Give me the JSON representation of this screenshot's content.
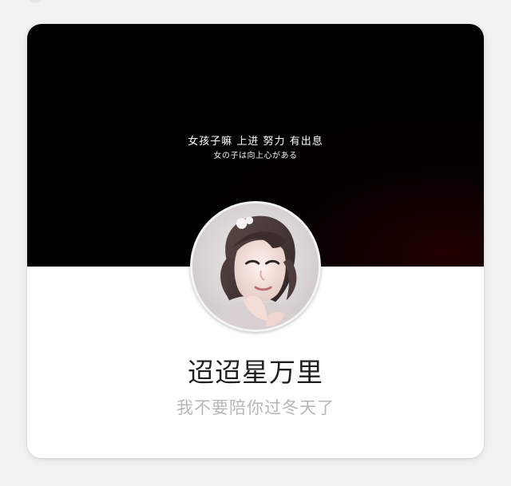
{
  "profile": {
    "banner_line1": "女孩子嘛 上进 努力 有出息",
    "banner_line2": "女の子は向上心がある",
    "username": "迢迢星万里",
    "bio": "我不要陪你过冬天了",
    "avatar_icon": "profile-photo"
  },
  "colors": {
    "banner": "#000000",
    "card": "#ffffff",
    "page_background": "#f3f2f3",
    "username": "#1f1f1f",
    "bio": "#b7b7b7"
  }
}
